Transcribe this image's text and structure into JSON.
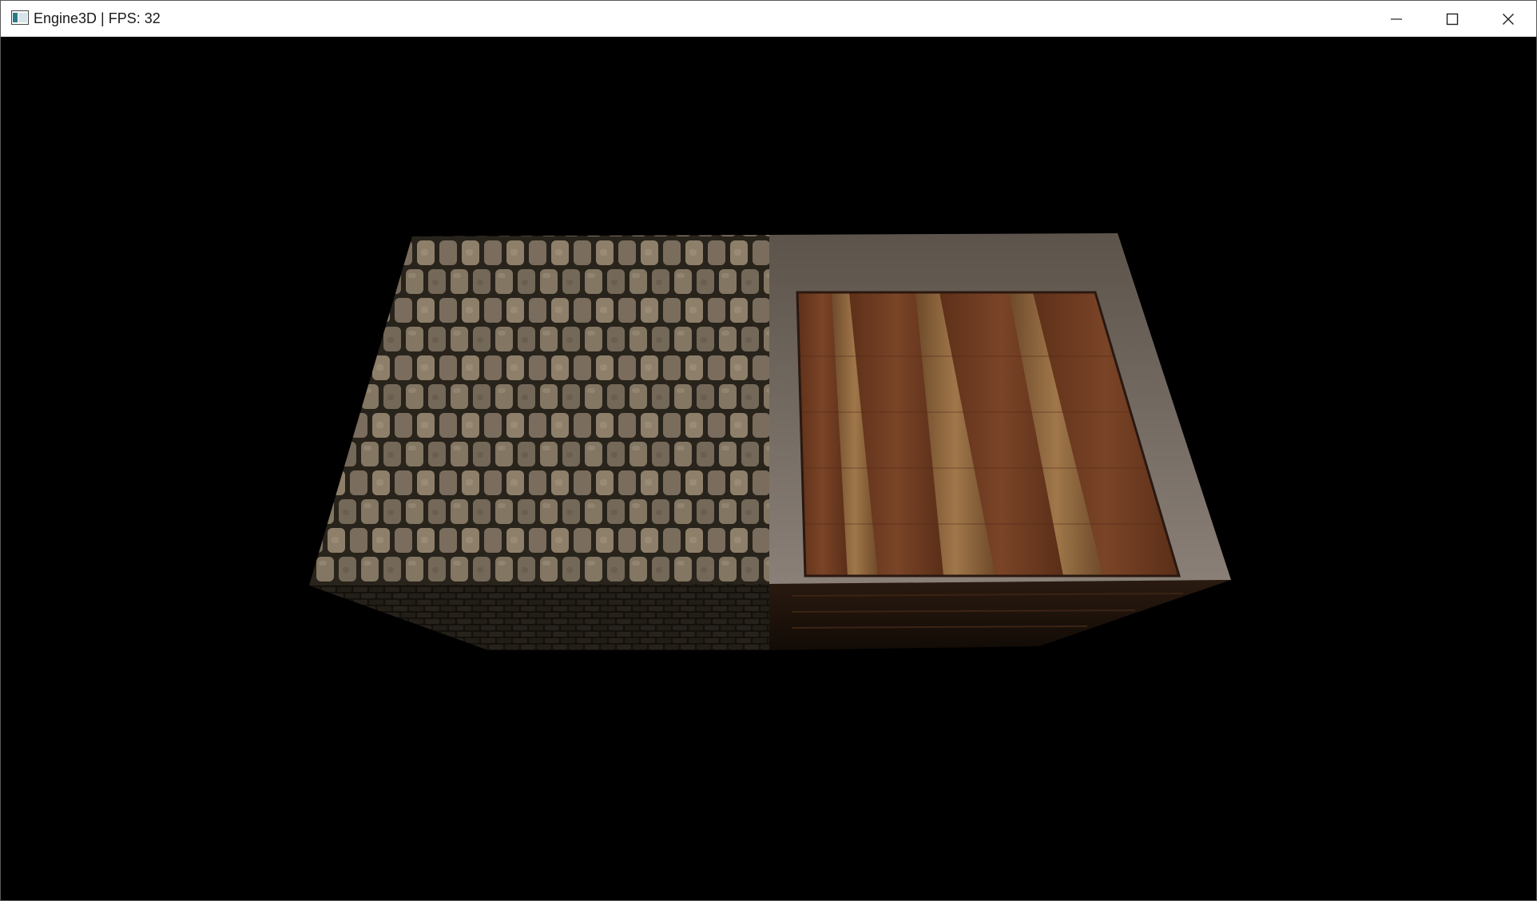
{
  "window": {
    "title": "Engine3D | FPS: 32",
    "icon": "app-window-icon",
    "controls": {
      "minimize": "minimize-icon",
      "maximize": "maximize-icon",
      "close": "close-icon"
    }
  },
  "scene": {
    "background": "#000000",
    "objects": [
      {
        "name": "stone-cube",
        "texture": "cobblestone",
        "color": "#8a7a62"
      },
      {
        "name": "wooden-crate",
        "texture": "wood-crate",
        "color": "#7a4427"
      }
    ]
  }
}
